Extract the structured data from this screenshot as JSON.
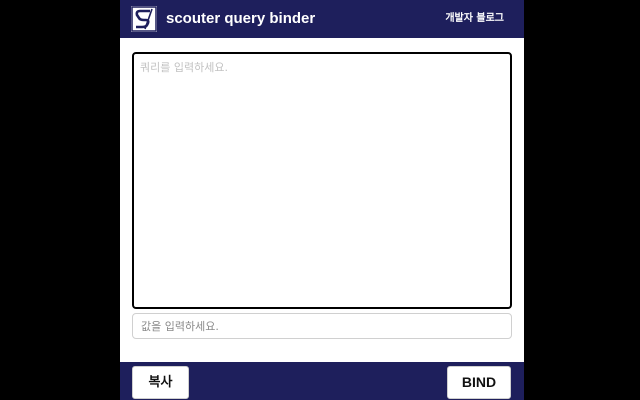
{
  "header": {
    "logo_icon": "scouter-s-logo-icon",
    "title": "scouter query binder",
    "blog_link": "개발자 블로그"
  },
  "editor": {
    "query_placeholder": "쿼리를 입력하세요.",
    "query_value": "",
    "value_placeholder": "값을 입력하세요.",
    "value_value": ""
  },
  "footer": {
    "copy_label": "복사",
    "bind_label": "BIND"
  },
  "colors": {
    "header_bg": "#1e1f5c",
    "page_bg": "#000000",
    "panel_bg": "#ffffff"
  }
}
